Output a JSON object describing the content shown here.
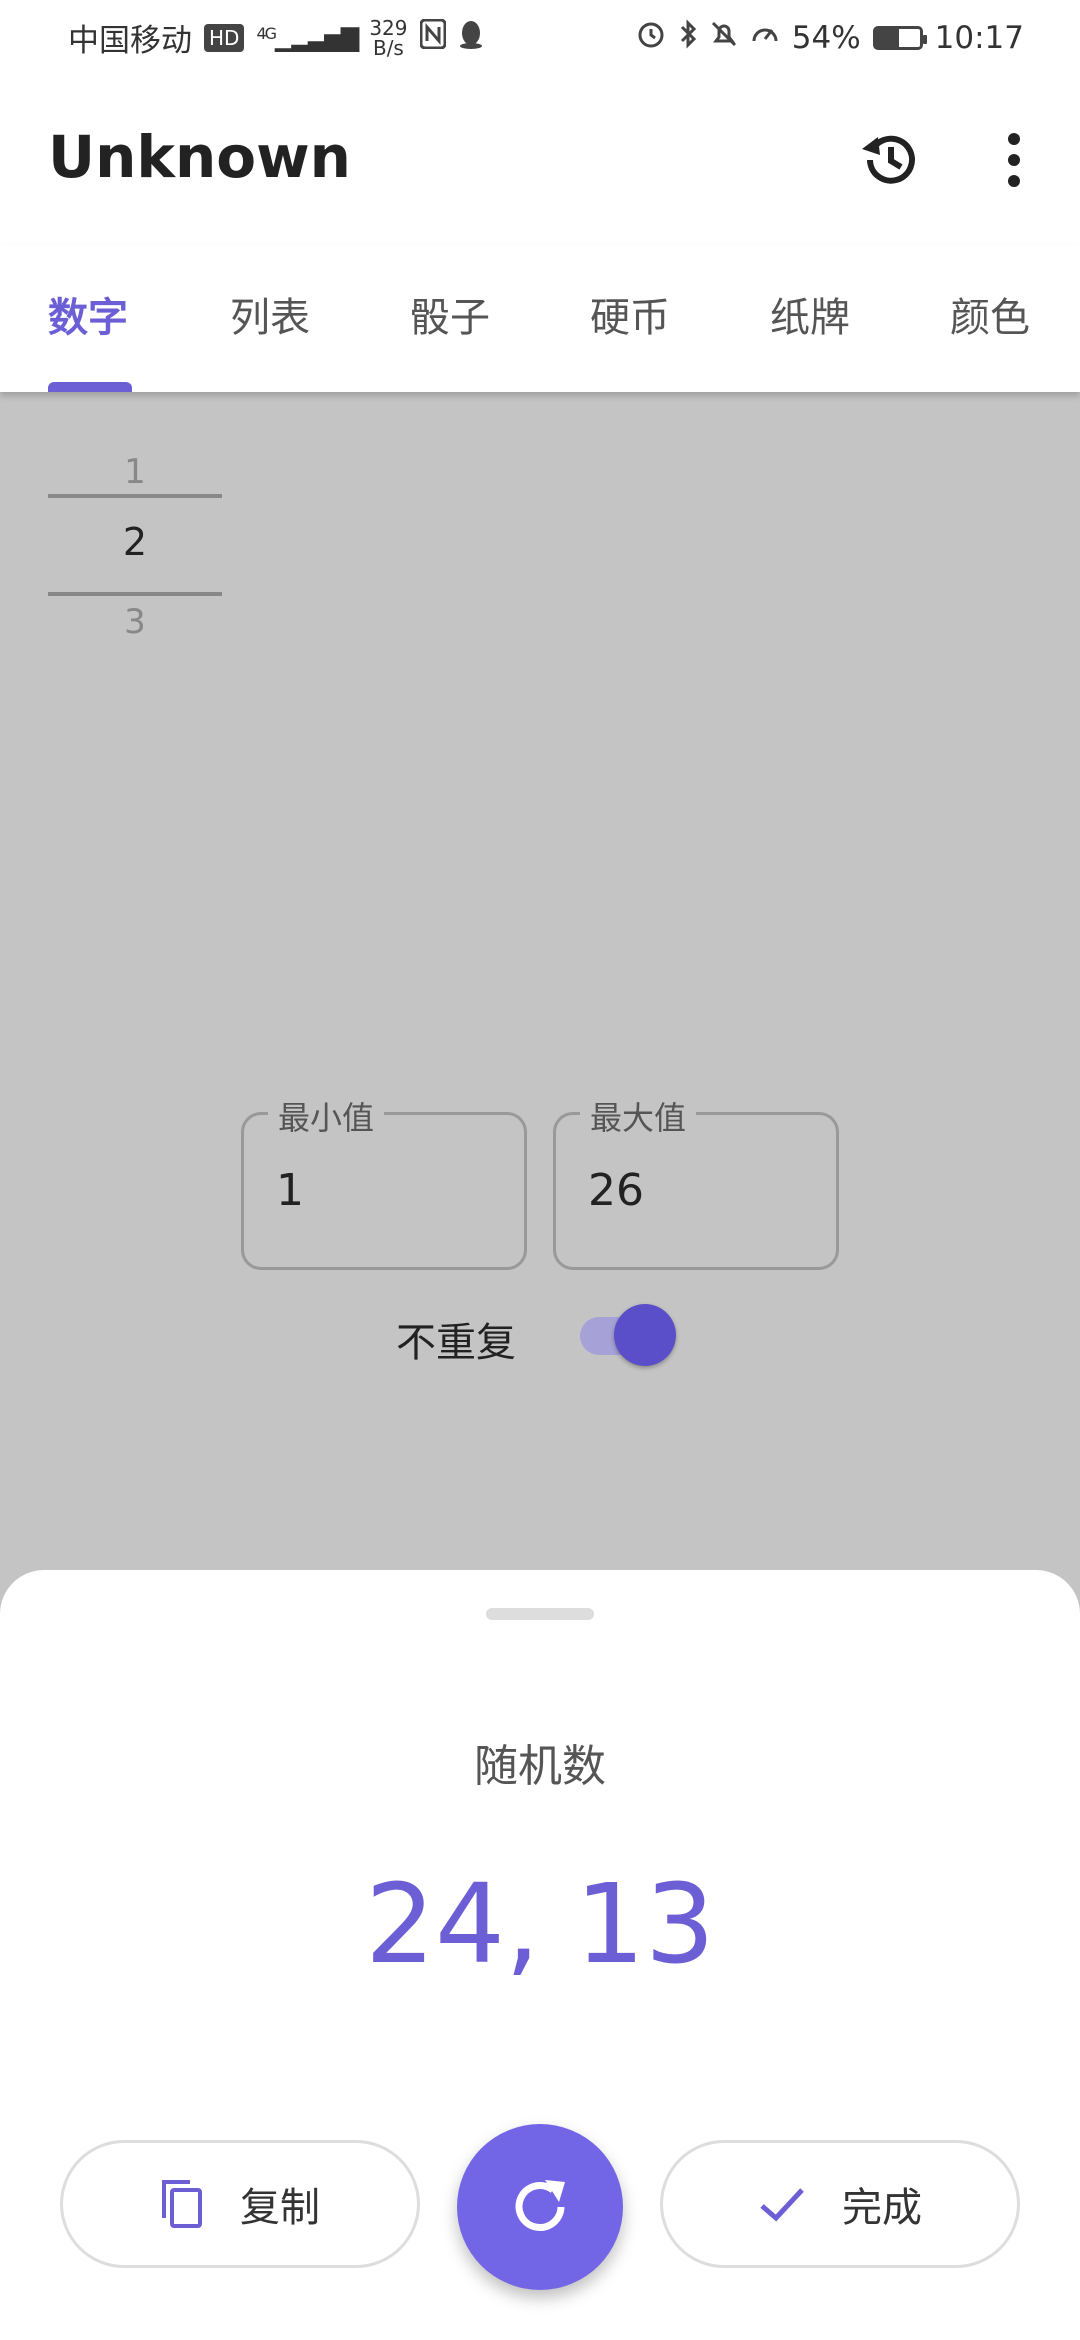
{
  "status": {
    "carrier": "中国移动",
    "hd": "HD",
    "network": "4G",
    "speed_top": "329",
    "speed_bottom": "B/s",
    "battery_pct": "54%",
    "battery_level": 0.54,
    "time": "10:17"
  },
  "app_bar": {
    "title": "Unknown"
  },
  "tabs": [
    {
      "label": "数字"
    },
    {
      "label": "列表"
    },
    {
      "label": "骰子"
    },
    {
      "label": "硬币"
    },
    {
      "label": "纸牌"
    },
    {
      "label": "颜色"
    }
  ],
  "picker": {
    "items": [
      "1",
      "2",
      "3"
    ]
  },
  "fields": {
    "min": {
      "label": "最小值",
      "value": "1"
    },
    "max": {
      "label": "最大值",
      "value": "26"
    }
  },
  "toggle": {
    "label": "不重复",
    "on": true
  },
  "sheet": {
    "title": "随机数",
    "result": "24, 13"
  },
  "buttons": {
    "copy": "复制",
    "done": "完成"
  },
  "colors": {
    "accent": "#6c5fd6",
    "fab": "#7366e6"
  }
}
